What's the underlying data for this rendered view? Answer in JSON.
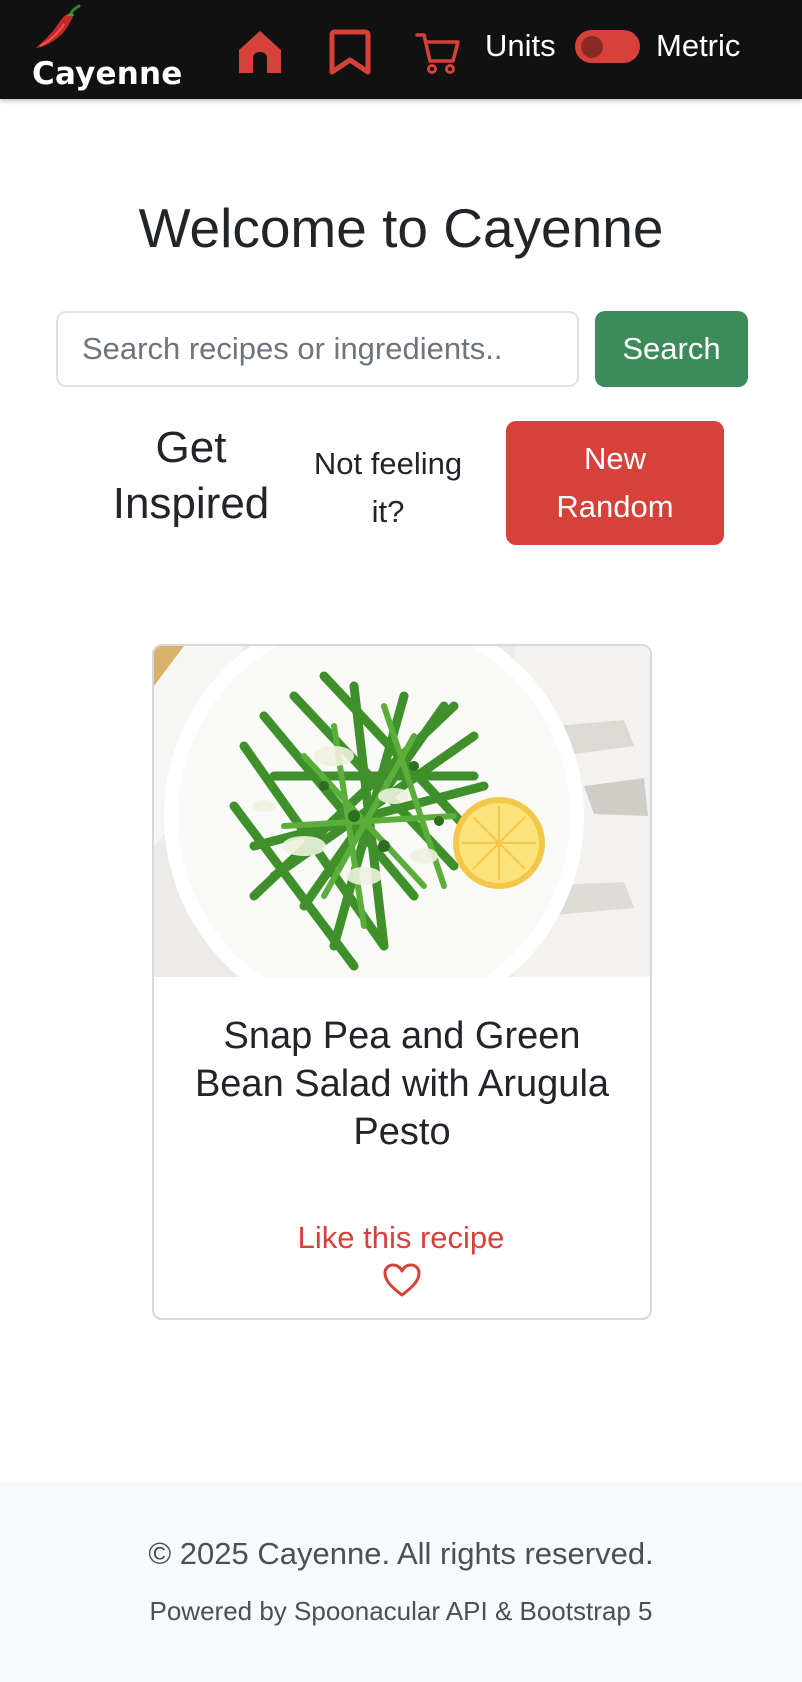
{
  "navbar": {
    "brand_name": "Cayenne",
    "brand_icon": "chili-pepper-icon",
    "home_icon": "home-icon",
    "bookmark_icon": "bookmark-icon",
    "cart_icon": "cart-icon",
    "units_label": "Units",
    "units_toggle_on": false,
    "metric_label": "Metric",
    "accent_color": "#d6413a"
  },
  "hero": {
    "title": "Welcome to Cayenne",
    "search_placeholder": "Search recipes or ingredients..",
    "search_button_label": "Search"
  },
  "inspire": {
    "title": "Get Inspired",
    "subtitle": "Not feeling it?",
    "random_button_label": "New Random"
  },
  "recipe_card": {
    "title": "Snap Pea and Green Bean Salad with Arugula Pesto",
    "like_label": "Like this recipe",
    "like_icon": "heart-outline-icon"
  },
  "footer": {
    "copyright": "© 2025 Cayenne. All rights reserved.",
    "powered_by": "Powered by Spoonacular API & Bootstrap 5"
  },
  "colors": {
    "navbar_bg": "#111111",
    "accent_red": "#d6413a",
    "search_green": "#3d8a5a",
    "footer_bg": "#f8f9fa"
  }
}
